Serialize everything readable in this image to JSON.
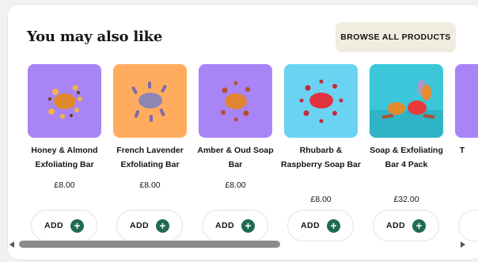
{
  "section": {
    "title": "You may also like",
    "browse_label": "BROWSE ALL PRODUCTS"
  },
  "products": [
    {
      "name": "Honey & Almond Exfoliating Bar",
      "price": "£8.00",
      "add_label": "ADD",
      "bg": "#a884f7",
      "soap": "#e0892c"
    },
    {
      "name": "French Lavender Exfoliating Bar",
      "price": "£8.00",
      "add_label": "ADD",
      "bg": "#ffac5e",
      "soap": "#8e87b6"
    },
    {
      "name": "Amber & Oud Soap Bar",
      "price": "£8.00",
      "add_label": "ADD",
      "bg": "#a884f7",
      "soap": "#e08632"
    },
    {
      "name": "Rhubarb & Raspberry Soap Bar",
      "price": "£8.00",
      "add_label": "ADD",
      "bg": "#6ad3f2",
      "soap": "#e0323f"
    },
    {
      "name": "Soap & Exfoliating Bar 4 Pack",
      "price": "£32.00",
      "add_label": "ADD",
      "bg": "#3bc7d9",
      "soap": "#e83a3a"
    },
    {
      "name": "T",
      "price": "",
      "add_label": "",
      "bg": "#a884f7",
      "soap": "#e0892c"
    }
  ],
  "scrollbar": {
    "position": 0.0
  },
  "colors": {
    "accent": "#1f6a54",
    "button_bg": "#f0ece0"
  },
  "icons": {
    "add": "plus-icon",
    "scroll_left": "arrow-left-icon",
    "scroll_right": "arrow-right-icon"
  }
}
